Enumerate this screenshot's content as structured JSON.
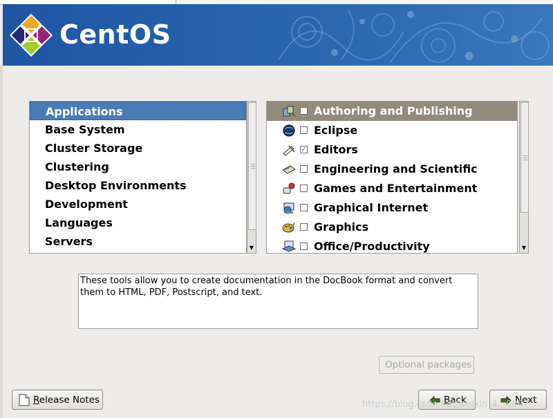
{
  "window": {
    "title": ""
  },
  "header": {
    "logo_text": "CentOS",
    "brand_colors": {
      "banner": "#1e56a3",
      "logo_purple": "#932279",
      "logo_green": "#9ccd2a",
      "logo_orange": "#efa724",
      "logo_blue": "#262577"
    }
  },
  "categories": {
    "selected_index": 0,
    "items": [
      {
        "label": "Applications"
      },
      {
        "label": "Base System"
      },
      {
        "label": "Cluster Storage"
      },
      {
        "label": "Clustering"
      },
      {
        "label": "Desktop Environments"
      },
      {
        "label": "Development"
      },
      {
        "label": "Languages"
      },
      {
        "label": "Servers"
      }
    ]
  },
  "packages": {
    "selected_index": 0,
    "items": [
      {
        "label": "Authoring and Publishing",
        "checked": false,
        "icon": "authoring-icon"
      },
      {
        "label": "Eclipse",
        "checked": false,
        "icon": "eclipse-icon"
      },
      {
        "label": "Editors",
        "checked": true,
        "icon": "editors-icon"
      },
      {
        "label": "Engineering and Scientific",
        "checked": false,
        "icon": "engineering-icon"
      },
      {
        "label": "Games and Entertainment",
        "checked": false,
        "icon": "games-icon"
      },
      {
        "label": "Graphical Internet",
        "checked": false,
        "icon": "internet-icon"
      },
      {
        "label": "Graphics",
        "checked": false,
        "icon": "graphics-icon"
      },
      {
        "label": "Office/Productivity",
        "checked": false,
        "icon": "office-icon"
      }
    ]
  },
  "description": {
    "text": "These tools allow you to create documentation in the DocBook format and convert them to HTML, PDF, Postscript, and text."
  },
  "buttons": {
    "optional_packages": {
      "label": "Optional packages",
      "enabled": false
    },
    "release_notes": {
      "label_underline": "R",
      "label_rest": "elease Notes"
    },
    "back": {
      "label_underline": "B",
      "label_rest": "ack"
    },
    "next": {
      "label_underline": "N",
      "label_rest": "ext"
    }
  },
  "watermark": {
    "text": "https://blog.csdn.net/weixin_4...0867"
  }
}
